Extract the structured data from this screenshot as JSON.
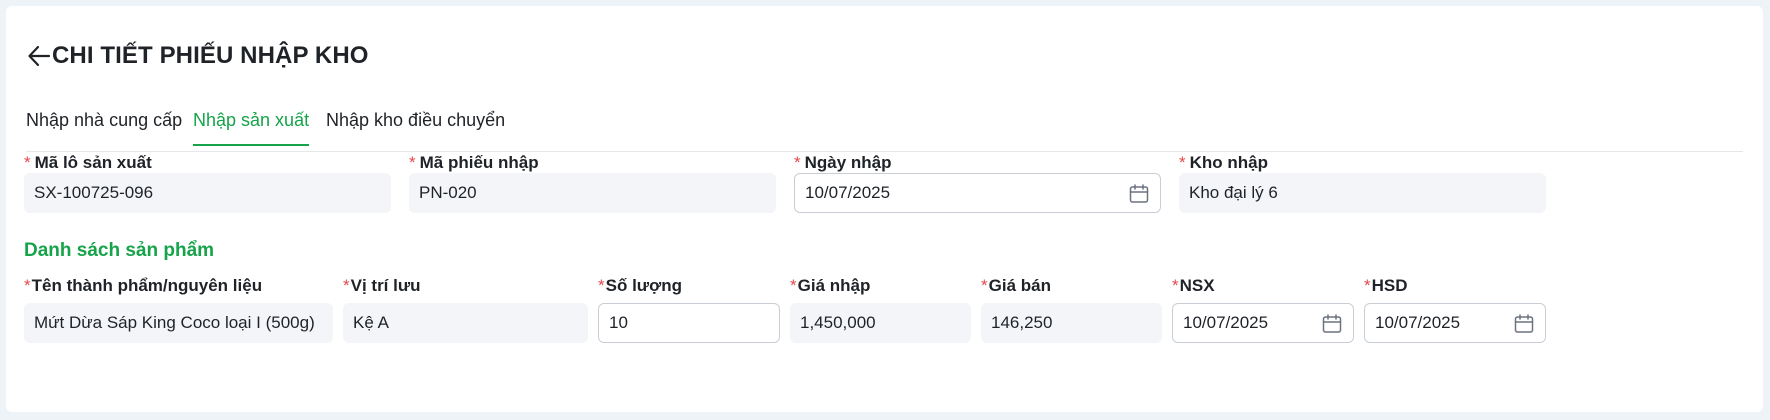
{
  "header": {
    "title": "CHI TIẾT PHIẾU NHẬP KHO",
    "back_icon": "arrow-left-icon"
  },
  "tabs": [
    {
      "label": "Nhập nhà cung cấp",
      "active": false
    },
    {
      "label": "Nhập sản xuất",
      "active": true
    },
    {
      "label": "Nhập kho điều chuyển",
      "active": false
    }
  ],
  "form": {
    "batch_code": {
      "label": "Mã lô sản xuất",
      "value": "SX-100725-096"
    },
    "receipt_code": {
      "label": "Mã phiếu nhập",
      "value": "PN-020"
    },
    "import_date": {
      "label": "Ngày nhập",
      "value": "10/07/2025",
      "icon": "calendar-icon"
    },
    "warehouse": {
      "label": "Kho nhập",
      "value": "Kho đại lý 6"
    }
  },
  "products": {
    "title": "Danh sách sản phẩm",
    "columns": {
      "name": "Tên thành phẩm/nguyên liệu",
      "location": "Vị trí lưu",
      "quantity": "Số lượng",
      "import_price": "Giá nhập",
      "sale_price": "Giá bán",
      "mfg_date": "NSX",
      "exp_date": "HSD"
    },
    "rows": [
      {
        "name": "Mứt Dừa Sáp King Coco loại I (500g)",
        "location": "Kệ A",
        "quantity": "10",
        "import_price": "1,450,000",
        "sale_price": "146,250",
        "mfg_date": "10/07/2025",
        "exp_date": "10/07/2025"
      }
    ]
  },
  "colors": {
    "accent": "#16a34a",
    "required": "#e5484d",
    "readonly_bg": "#f3f5f8",
    "page_bg": "#eef3f8"
  }
}
